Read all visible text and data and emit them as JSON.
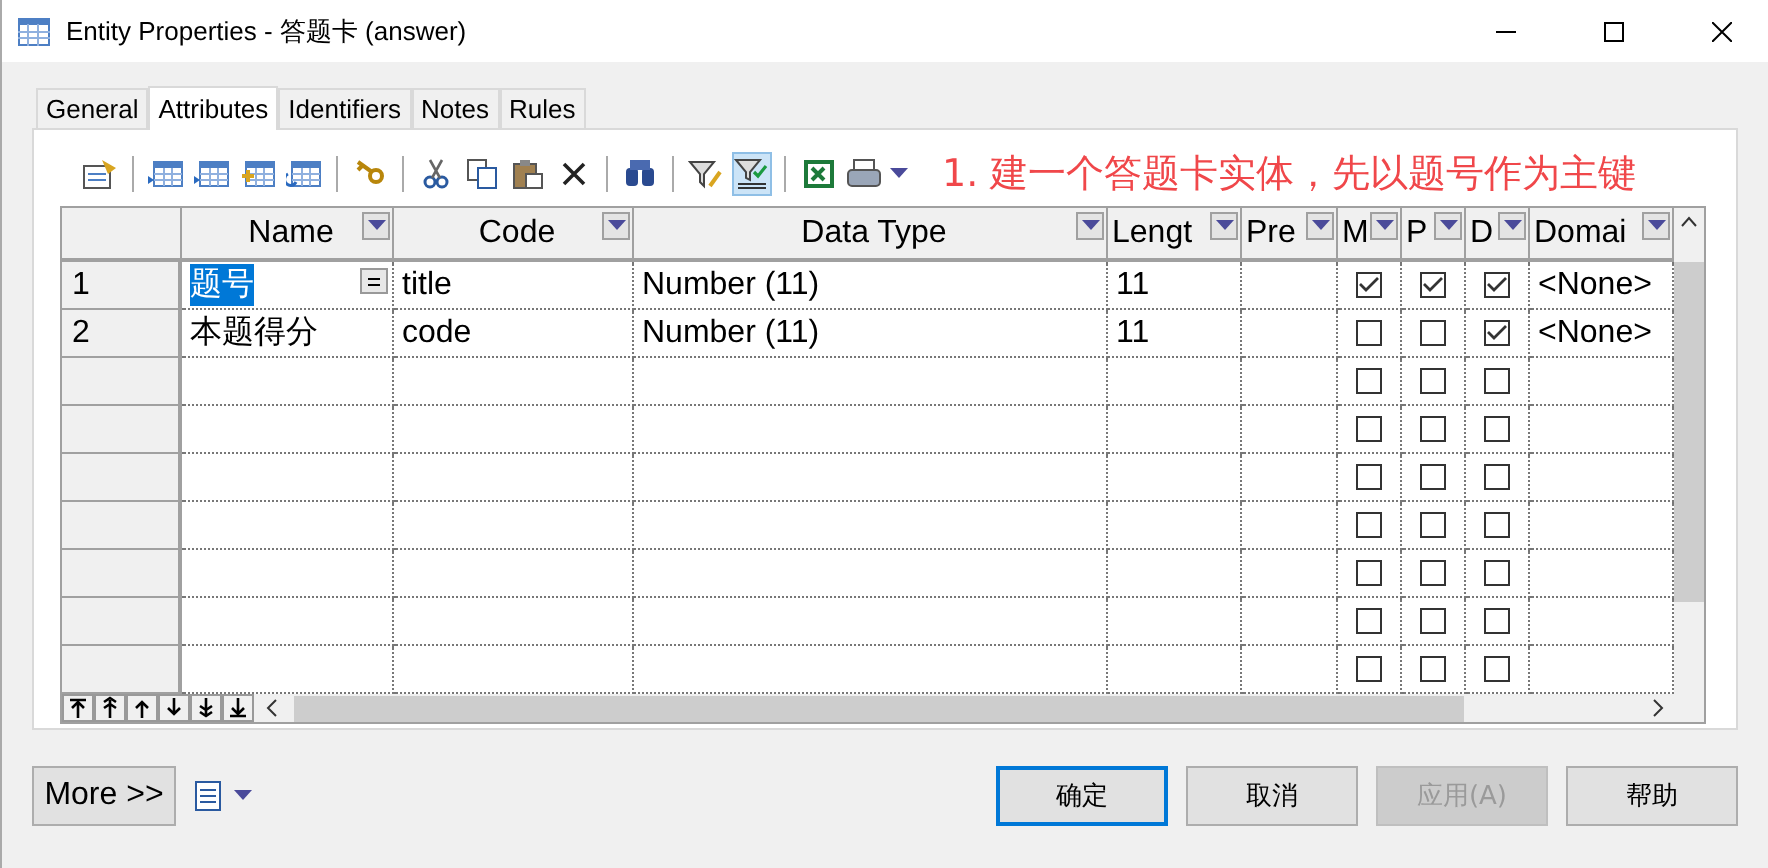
{
  "window": {
    "title": "Entity Properties - 答题卡 (answer)"
  },
  "tabs": [
    {
      "label": "General",
      "selected": false
    },
    {
      "label": "Attributes",
      "selected": true
    },
    {
      "label": "Identifiers",
      "selected": false
    },
    {
      "label": "Notes",
      "selected": false
    },
    {
      "label": "Rules",
      "selected": false
    }
  ],
  "annotation": "1.  建一个答题卡实体，先以题号作为主键",
  "table": {
    "columns": [
      "Name",
      "Code",
      "Data Type",
      "Lengt",
      "Pre",
      "M",
      "P",
      "D",
      "Domai"
    ],
    "rows": [
      {
        "number": "1",
        "name": "题号",
        "code": "title",
        "data_type": "Number (11)",
        "length": "11",
        "domain": "<None>",
        "selected": true,
        "m": true,
        "p": true,
        "d": true
      },
      {
        "number": "2",
        "name": "本题得分",
        "code": "code",
        "data_type": "Number (11)",
        "length": "11",
        "domain": "<None>",
        "selected": false,
        "m": false,
        "p": false,
        "d": true
      },
      {
        "selected": false,
        "m": false,
        "p": false,
        "d": false
      },
      {
        "selected": false,
        "m": false,
        "p": false,
        "d": false
      },
      {
        "selected": false,
        "m": false,
        "p": false,
        "d": false
      },
      {
        "selected": false,
        "m": false,
        "p": false,
        "d": false
      },
      {
        "selected": false,
        "m": false,
        "p": false,
        "d": false
      },
      {
        "selected": false,
        "m": false,
        "p": false,
        "d": false
      },
      {
        "selected": false,
        "m": false,
        "p": false,
        "d": false
      }
    ]
  },
  "more_button": "More >>",
  "buttons": [
    {
      "label": "确定",
      "kind": "default",
      "disabled": false
    },
    {
      "label": "取消",
      "kind": "normal",
      "disabled": false
    },
    {
      "label": "应用(A)",
      "kind": "normal",
      "disabled": true
    },
    {
      "label": "帮助",
      "kind": "normal",
      "disabled": false
    }
  ]
}
